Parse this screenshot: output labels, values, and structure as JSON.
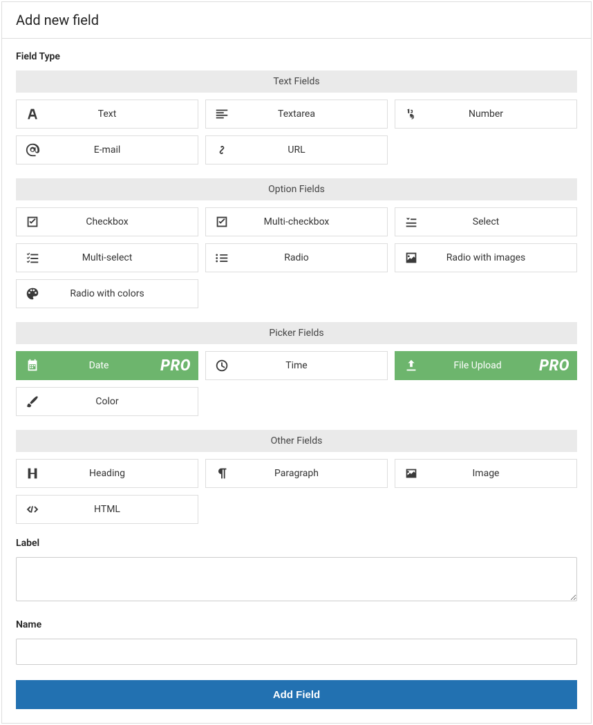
{
  "header": {
    "title": "Add new field"
  },
  "fieldType": {
    "label": "Field Type",
    "groups": [
      {
        "title": "Text Fields",
        "options": [
          {
            "label": "Text"
          },
          {
            "label": "Textarea"
          },
          {
            "label": "Number"
          },
          {
            "label": "E-mail"
          },
          {
            "label": "URL"
          }
        ]
      },
      {
        "title": "Option Fields",
        "options": [
          {
            "label": "Checkbox"
          },
          {
            "label": "Multi-checkbox"
          },
          {
            "label": "Select"
          },
          {
            "label": "Multi-select"
          },
          {
            "label": "Radio"
          },
          {
            "label": "Radio with images"
          },
          {
            "label": "Radio with colors"
          }
        ]
      },
      {
        "title": "Picker Fields",
        "options": [
          {
            "label": "Date",
            "pro": true,
            "badge": "PRO"
          },
          {
            "label": "Time"
          },
          {
            "label": "File Upload",
            "pro": true,
            "badge": "PRO"
          },
          {
            "label": "Color"
          }
        ]
      },
      {
        "title": "Other Fields",
        "options": [
          {
            "label": "Heading"
          },
          {
            "label": "Paragraph"
          },
          {
            "label": "Image"
          },
          {
            "label": "HTML"
          }
        ]
      }
    ]
  },
  "labelField": {
    "label": "Label",
    "value": ""
  },
  "nameField": {
    "label": "Name",
    "value": ""
  },
  "submit": {
    "label": "Add Field"
  }
}
